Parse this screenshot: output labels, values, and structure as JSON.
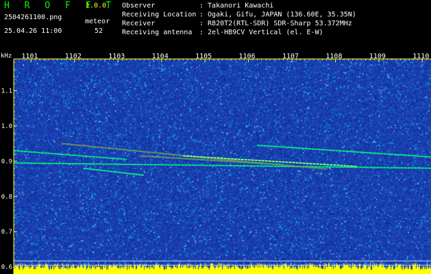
{
  "header": {
    "app_name": "H R O F F T",
    "version": "1.0.0",
    "file_name": "2504261100.png",
    "timestamp": "25.04.26 11:00",
    "meteor_label": "meteor",
    "meteor_count": "52",
    "info": [
      {
        "key": "Observer",
        "value": ": Takanori Kawachi"
      },
      {
        "key": "Receiving Location",
        "value": ": Ogaki, Gifu, JAPAN (136.60E, 35.35N)"
      },
      {
        "key": "Receiver",
        "value": ": R820T2(RTL-SDR) SDR-Sharp 53.372MHz"
      },
      {
        "key": "Receiving antenna",
        "value": ": 2el-HB9CV Vertical (el. E-W)"
      }
    ]
  },
  "chart_data": {
    "type": "heatmap",
    "ylabel": "kHz",
    "x_ticks": [
      "1101",
      "1102",
      "1103",
      "1104",
      "1105",
      "1106",
      "1107",
      "1108",
      "1109",
      "1110"
    ],
    "y_ticks": [
      "1.1",
      "1.0",
      "0.9",
      "0.8",
      "0.7",
      "0.6"
    ],
    "x_range": [
      1100.6,
      1110.2
    ],
    "y_range": [
      0.58,
      1.19
    ],
    "colors": {
      "background": "#1a3fb0",
      "noise": "#00c8ff",
      "trail_warm": "#ff3a1a",
      "trail_green": "#00ff80",
      "reference_lines": "#c8c8ff",
      "bottom_band": "#ffff00",
      "ticks": "#ffff00",
      "axis_text": "#ffffff"
    },
    "trails": [
      {
        "from": [
          1100.6,
          0.93
        ],
        "to": [
          1103.2,
          0.905
        ],
        "color": "#00ff80"
      },
      {
        "from": [
          1101.7,
          0.95
        ],
        "to": [
          1105.8,
          0.9
        ],
        "color": "#ff3a1a"
      },
      {
        "from": [
          1100.6,
          0.895
        ],
        "to": [
          1110.2,
          0.88
        ],
        "color": "#00ff80"
      },
      {
        "from": [
          1103.5,
          0.915
        ],
        "to": [
          1106.8,
          0.89
        ],
        "color": "#ff3a1a"
      },
      {
        "from": [
          1104.5,
          0.915
        ],
        "to": [
          1108.5,
          0.885
        ],
        "color": "#ffff60"
      },
      {
        "from": [
          1106.2,
          0.945
        ],
        "to": [
          1110.2,
          0.912
        ],
        "color": "#00ff80"
      },
      {
        "from": [
          1105.8,
          0.9
        ],
        "to": [
          1107.8,
          0.878
        ],
        "color": "#ff3a1a"
      },
      {
        "from": [
          1102.2,
          0.88
        ],
        "to": [
          1103.6,
          0.86
        ],
        "color": "#00ff80"
      }
    ],
    "reference_lines_y": [
      0.617,
      0.605
    ]
  }
}
